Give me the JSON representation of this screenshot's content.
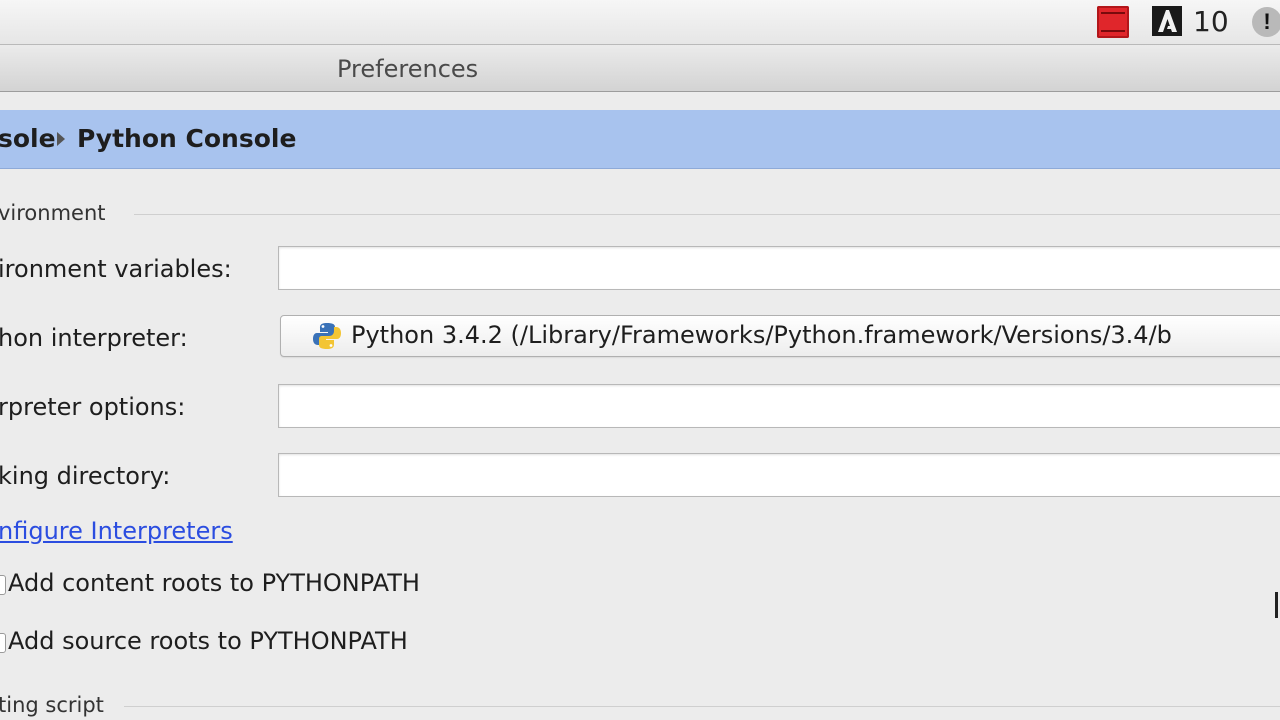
{
  "menubar": {
    "adobe_badge_count": "10",
    "alert_icon_glyph": "!"
  },
  "window": {
    "title": "Preferences"
  },
  "breadcrumb": {
    "parent": "sole",
    "current": "Python Console"
  },
  "sections": {
    "environment_title": "vironment",
    "starting_script_title": "ting script"
  },
  "fields": {
    "env_vars_label": "ironment variables:",
    "env_vars_value": "",
    "interpreter_label": "hon interpreter:",
    "interpreter_value": "Python 3.4.2 (/Library/Frameworks/Python.framework/Versions/3.4/b",
    "interp_options_label": "rpreter options:",
    "interp_options_value": "",
    "working_dir_label": "king directory:",
    "working_dir_value": ""
  },
  "links": {
    "configure_interpreters": "nfigure Interpreters"
  },
  "checkboxes": [
    {
      "label": "Add content roots to PYTHONPATH"
    },
    {
      "label": "Add source roots to PYTHONPATH"
    }
  ],
  "colors": {
    "breadcrumb_bg": "#a8c3ee",
    "link": "#2b4de0",
    "window_bg": "#ececec"
  },
  "icons": {
    "record": "screen-recorder-icon",
    "adobe": "adobe-icon",
    "alert": "alert-icon",
    "python": "python-icon"
  }
}
